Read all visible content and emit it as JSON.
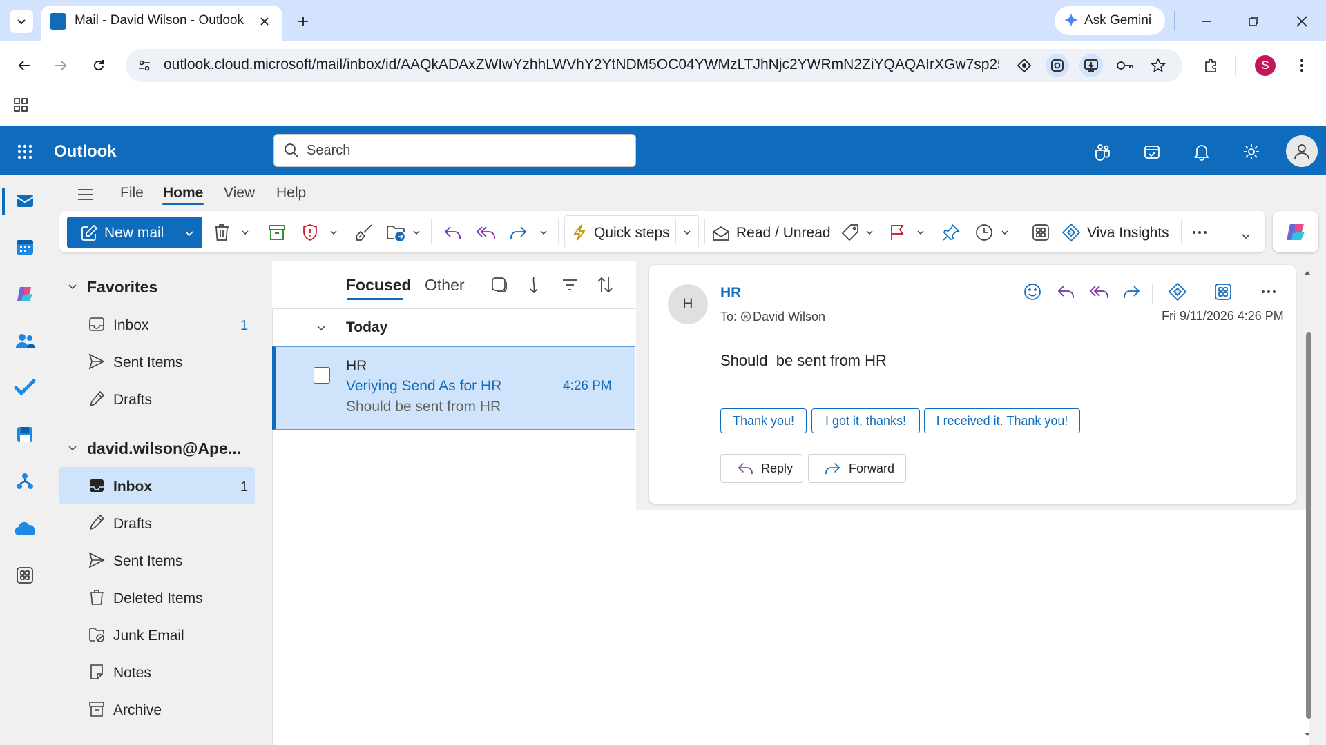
{
  "browser": {
    "tab_title": "Mail - David Wilson - Outlook",
    "url": "outlook.cloud.microsoft/mail/inbox/id/AAQkADAxZWIwYzhhLWVhY2YtNDM5OC04YWMzLTJhNjc2YWRmN2ZiYQAQAIrXGw7sp25...",
    "gemini_label": "Ask Gemini",
    "profile_initial": "S"
  },
  "header": {
    "app_name": "Outlook",
    "search_placeholder": "Search"
  },
  "menu": {
    "file": "File",
    "home": "Home",
    "view": "View",
    "help": "Help"
  },
  "ribbon": {
    "new_mail": "New mail",
    "quick_steps": "Quick steps",
    "read_unread": "Read / Unread",
    "viva_insights": "Viva Insights"
  },
  "folders": {
    "favorites_label": "Favorites",
    "favorites": [
      {
        "label": "Inbox",
        "count": "1"
      },
      {
        "label": "Sent Items"
      },
      {
        "label": "Drafts"
      }
    ],
    "account_label": "david.wilson@Ape...",
    "account": [
      {
        "label": "Inbox",
        "count": "1"
      },
      {
        "label": "Drafts"
      },
      {
        "label": "Sent Items"
      },
      {
        "label": "Deleted Items"
      },
      {
        "label": "Junk Email"
      },
      {
        "label": "Notes"
      },
      {
        "label": "Archive"
      }
    ]
  },
  "list": {
    "tab_focused": "Focused",
    "tab_other": "Other",
    "group_label": "Today",
    "message": {
      "sender": "HR",
      "subject": "Veriying Send As for HR",
      "preview": "Should be sent from HR",
      "time": "4:26 PM"
    }
  },
  "reading": {
    "avatar_initial": "H",
    "sender": "HR",
    "to_prefix": "To:",
    "recipient": "David Wilson",
    "date": "Fri 9/11/2026 4:26 PM",
    "body": "Should  be sent from HR",
    "quick_replies": [
      "Thank you!",
      "I got it, thanks!",
      "I received it. Thank you!"
    ],
    "reply": "Reply",
    "forward": "Forward"
  },
  "colors": {
    "brand": "#0f6cbd",
    "selection": "#cfe4fa",
    "chrome_tabstrip": "#d3e3fd"
  }
}
